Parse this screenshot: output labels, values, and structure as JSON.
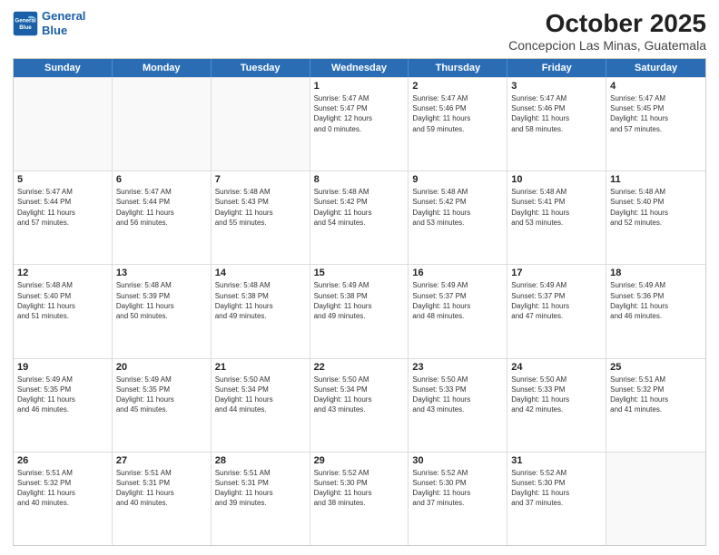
{
  "logo": {
    "line1": "General",
    "line2": "Blue"
  },
  "header": {
    "month": "October 2025",
    "location": "Concepcion Las Minas, Guatemala"
  },
  "days": [
    "Sunday",
    "Monday",
    "Tuesday",
    "Wednesday",
    "Thursday",
    "Friday",
    "Saturday"
  ],
  "rows": [
    [
      {
        "day": "",
        "info": ""
      },
      {
        "day": "",
        "info": ""
      },
      {
        "day": "",
        "info": ""
      },
      {
        "day": "1",
        "info": "Sunrise: 5:47 AM\nSunset: 5:47 PM\nDaylight: 12 hours\nand 0 minutes."
      },
      {
        "day": "2",
        "info": "Sunrise: 5:47 AM\nSunset: 5:46 PM\nDaylight: 11 hours\nand 59 minutes."
      },
      {
        "day": "3",
        "info": "Sunrise: 5:47 AM\nSunset: 5:46 PM\nDaylight: 11 hours\nand 58 minutes."
      },
      {
        "day": "4",
        "info": "Sunrise: 5:47 AM\nSunset: 5:45 PM\nDaylight: 11 hours\nand 57 minutes."
      }
    ],
    [
      {
        "day": "5",
        "info": "Sunrise: 5:47 AM\nSunset: 5:44 PM\nDaylight: 11 hours\nand 57 minutes."
      },
      {
        "day": "6",
        "info": "Sunrise: 5:47 AM\nSunset: 5:44 PM\nDaylight: 11 hours\nand 56 minutes."
      },
      {
        "day": "7",
        "info": "Sunrise: 5:48 AM\nSunset: 5:43 PM\nDaylight: 11 hours\nand 55 minutes."
      },
      {
        "day": "8",
        "info": "Sunrise: 5:48 AM\nSunset: 5:42 PM\nDaylight: 11 hours\nand 54 minutes."
      },
      {
        "day": "9",
        "info": "Sunrise: 5:48 AM\nSunset: 5:42 PM\nDaylight: 11 hours\nand 53 minutes."
      },
      {
        "day": "10",
        "info": "Sunrise: 5:48 AM\nSunset: 5:41 PM\nDaylight: 11 hours\nand 53 minutes."
      },
      {
        "day": "11",
        "info": "Sunrise: 5:48 AM\nSunset: 5:40 PM\nDaylight: 11 hours\nand 52 minutes."
      }
    ],
    [
      {
        "day": "12",
        "info": "Sunrise: 5:48 AM\nSunset: 5:40 PM\nDaylight: 11 hours\nand 51 minutes."
      },
      {
        "day": "13",
        "info": "Sunrise: 5:48 AM\nSunset: 5:39 PM\nDaylight: 11 hours\nand 50 minutes."
      },
      {
        "day": "14",
        "info": "Sunrise: 5:48 AM\nSunset: 5:38 PM\nDaylight: 11 hours\nand 49 minutes."
      },
      {
        "day": "15",
        "info": "Sunrise: 5:49 AM\nSunset: 5:38 PM\nDaylight: 11 hours\nand 49 minutes."
      },
      {
        "day": "16",
        "info": "Sunrise: 5:49 AM\nSunset: 5:37 PM\nDaylight: 11 hours\nand 48 minutes."
      },
      {
        "day": "17",
        "info": "Sunrise: 5:49 AM\nSunset: 5:37 PM\nDaylight: 11 hours\nand 47 minutes."
      },
      {
        "day": "18",
        "info": "Sunrise: 5:49 AM\nSunset: 5:36 PM\nDaylight: 11 hours\nand 46 minutes."
      }
    ],
    [
      {
        "day": "19",
        "info": "Sunrise: 5:49 AM\nSunset: 5:35 PM\nDaylight: 11 hours\nand 46 minutes."
      },
      {
        "day": "20",
        "info": "Sunrise: 5:49 AM\nSunset: 5:35 PM\nDaylight: 11 hours\nand 45 minutes."
      },
      {
        "day": "21",
        "info": "Sunrise: 5:50 AM\nSunset: 5:34 PM\nDaylight: 11 hours\nand 44 minutes."
      },
      {
        "day": "22",
        "info": "Sunrise: 5:50 AM\nSunset: 5:34 PM\nDaylight: 11 hours\nand 43 minutes."
      },
      {
        "day": "23",
        "info": "Sunrise: 5:50 AM\nSunset: 5:33 PM\nDaylight: 11 hours\nand 43 minutes."
      },
      {
        "day": "24",
        "info": "Sunrise: 5:50 AM\nSunset: 5:33 PM\nDaylight: 11 hours\nand 42 minutes."
      },
      {
        "day": "25",
        "info": "Sunrise: 5:51 AM\nSunset: 5:32 PM\nDaylight: 11 hours\nand 41 minutes."
      }
    ],
    [
      {
        "day": "26",
        "info": "Sunrise: 5:51 AM\nSunset: 5:32 PM\nDaylight: 11 hours\nand 40 minutes."
      },
      {
        "day": "27",
        "info": "Sunrise: 5:51 AM\nSunset: 5:31 PM\nDaylight: 11 hours\nand 40 minutes."
      },
      {
        "day": "28",
        "info": "Sunrise: 5:51 AM\nSunset: 5:31 PM\nDaylight: 11 hours\nand 39 minutes."
      },
      {
        "day": "29",
        "info": "Sunrise: 5:52 AM\nSunset: 5:30 PM\nDaylight: 11 hours\nand 38 minutes."
      },
      {
        "day": "30",
        "info": "Sunrise: 5:52 AM\nSunset: 5:30 PM\nDaylight: 11 hours\nand 37 minutes."
      },
      {
        "day": "31",
        "info": "Sunrise: 5:52 AM\nSunset: 5:30 PM\nDaylight: 11 hours\nand 37 minutes."
      },
      {
        "day": "",
        "info": ""
      }
    ]
  ]
}
